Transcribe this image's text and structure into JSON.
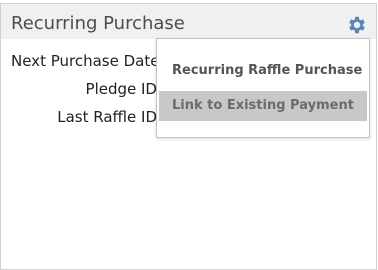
{
  "panel": {
    "title": "Recurring Purchase",
    "settings_icon": "gear-icon",
    "fields": [
      {
        "label": "Next Purchase Date"
      },
      {
        "label": "Pledge ID"
      },
      {
        "label": "Last Raffle ID"
      }
    ]
  },
  "menu": {
    "items": [
      {
        "label": "Recurring Raffle Purchase",
        "highlighted": false
      },
      {
        "label": "Link to Existing Payment",
        "highlighted": true
      }
    ]
  },
  "colors": {
    "gear": "#5b86b6",
    "header_bg": "#f0f0f0",
    "highlight_bg": "#c8c8c8"
  }
}
